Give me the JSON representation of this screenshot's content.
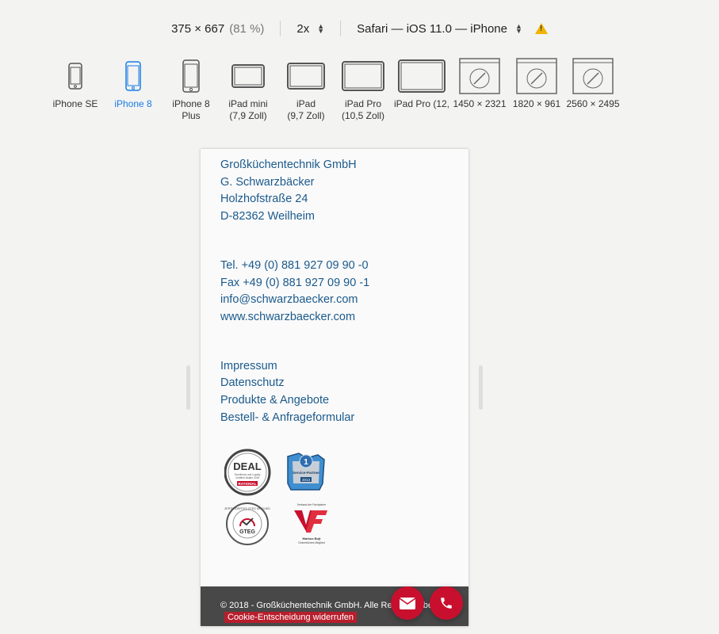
{
  "toolbar": {
    "size": "375 × 667",
    "scale_percent": "(81 %)",
    "pixel_ratio": "2x",
    "browser": "Safari — iOS 11.0 — iPhone",
    "warning_icon": "warning-icon"
  },
  "devices": [
    {
      "label": "iPhone SE",
      "sub": ""
    },
    {
      "label": "iPhone 8",
      "sub": ""
    },
    {
      "label": "iPhone 8",
      "sub": "Plus"
    },
    {
      "label": "iPad mini",
      "sub": "(7,9 Zoll)"
    },
    {
      "label": "iPad",
      "sub": "(9,7 Zoll)"
    },
    {
      "label": "iPad Pro",
      "sub": "(10,5 Zoll)"
    },
    {
      "label": "iPad Pro (12,",
      "sub": ""
    },
    {
      "label": "1450 × 2321",
      "sub": ""
    },
    {
      "label": "1820 × 961",
      "sub": ""
    },
    {
      "label": "2560 × 2495",
      "sub": ""
    }
  ],
  "active_device": "iPhone 8",
  "page": {
    "address": [
      "Großküchentechnik GmbH",
      "G. Schwarzbäcker",
      "Holzhofstraße 24",
      "D-82362 Weilheim"
    ],
    "contact": [
      "Tel. +49 (0) 881 927 09 90 -0",
      "Fax +49 (0) 881 927 09 90 -1",
      "info@schwarzbaecker.com",
      "www.schwarzbaecker.com"
    ],
    "links": [
      "Impressum",
      "Datenschutz",
      "Produkte & Angebote",
      "Bestell- & Anfrageformular"
    ],
    "badges": {
      "deal": {
        "title": "DEAL",
        "line1": "Excellence and Loyalty",
        "line2": "Certified Dealer 2018",
        "brand": "RATIONAL"
      },
      "service_partner": {
        "line1": "Service-Partner",
        "year": "2013"
      },
      "gteg": {
        "ring": "ZERTIFIZIERTES GTEG MITGLIED",
        "name": "GTEG"
      },
      "vdf": {
        "org": "Verband der Fachplaner",
        "person": "Markus Bojt",
        "member": "Ordentliches Mitglied"
      }
    },
    "footer": {
      "copyright": "© 2018 - Großküchentechnik GmbH. Alle Rechte vorbehal",
      "cookie": "Cookie-Entscheidung widerrufen"
    }
  },
  "colors": {
    "link_blue": "#1b5a8c",
    "accent_red": "#c8102e",
    "active_device_blue": "#1a7ce6",
    "footer_bg": "#484848"
  }
}
